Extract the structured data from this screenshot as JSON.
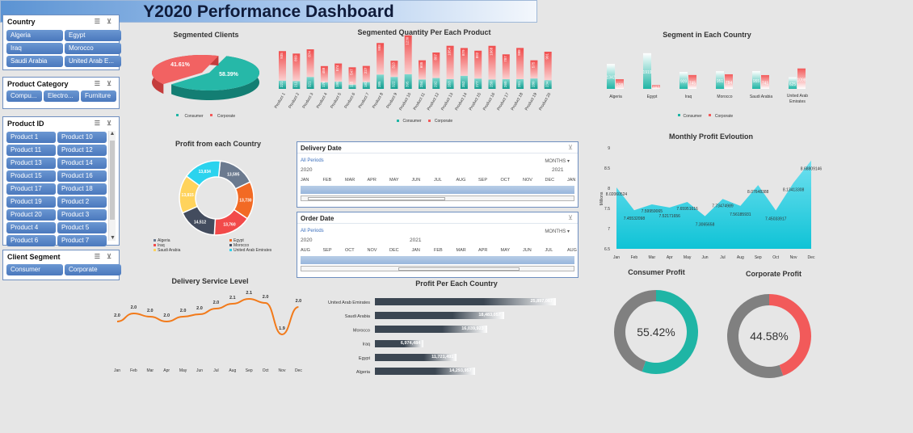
{
  "header": {
    "title": "Y2020 Performance Dashboard"
  },
  "slicers": {
    "country": {
      "title": "Country",
      "items": [
        "Algeria",
        "Egypt",
        "Iraq",
        "Morocco",
        "Saudi Arabia",
        "United Arab E..."
      ]
    },
    "category": {
      "title": "Product Category",
      "items": [
        "Compu...",
        "Electro...",
        "Furniture"
      ]
    },
    "product": {
      "title": "Product ID",
      "items": [
        "Product 1",
        "Product 10",
        "Product 11",
        "Product 12",
        "Product 13",
        "Product 14",
        "Product 15",
        "Product 16",
        "Product 17",
        "Product 18",
        "Product 19",
        "Product 2",
        "Product 20",
        "Product 3",
        "Product 4",
        "Product 5",
        "Product 6",
        "Product 7"
      ]
    },
    "segment": {
      "title": "Client Segment",
      "items": [
        "Consumer",
        "Corporate"
      ]
    }
  },
  "timelines": {
    "delivery": {
      "title": "Delivery Date",
      "all": "All Periods",
      "unit": "MONTHS",
      "years": [
        "2020",
        "2021"
      ],
      "months": [
        "JAN",
        "FEB",
        "MAR",
        "APR",
        "MAY",
        "JUN",
        "JUL",
        "AUG",
        "SEP",
        "OCT",
        "NOV",
        "DEC",
        "JAN"
      ]
    },
    "order": {
      "title": "Order Date",
      "all": "All Periods",
      "unit": "MONTHS",
      "years": [
        "2020",
        "2021"
      ],
      "months": [
        "AUG",
        "SEP",
        "OCT",
        "NOV",
        "DEC",
        "JAN",
        "FEB",
        "MAR",
        "APR",
        "MAY",
        "JUN",
        "JUL",
        "AUG"
      ]
    }
  },
  "colors": {
    "consumer": "#1fb5a5",
    "corporate": "#f25a5a",
    "navy": "#3b4652"
  },
  "chart_data": [
    {
      "id": "segmented_clients",
      "type": "pie",
      "title": "Segmented Clients",
      "labels": [
        "Consumer",
        "Corporate"
      ],
      "values": [
        58.39,
        41.61
      ],
      "value_labels": [
        "58.39%",
        "41.61%"
      ],
      "legend": [
        "Consumer",
        "Corporate"
      ]
    },
    {
      "id": "qty_product",
      "type": "bar",
      "title": "Segmented Quantity Per Each Product",
      "categories": [
        "Product 1",
        "Product 2",
        "Product 3",
        "Product 4",
        "Product 5",
        "Product 6",
        "Product 7",
        "Product 8",
        "Product 9",
        "Product 10",
        "Product 11",
        "Product 12",
        "Product 13",
        "Product 14",
        "Product 15",
        "Product 16",
        "Product 17",
        "Product 18",
        "Product 19",
        "Product 20"
      ],
      "series": [
        {
          "name": "Consumer",
          "values": [
            221,
            211,
            321,
            178,
            195,
            115,
            182,
            385,
            322,
            395,
            254,
            292,
            263,
            352,
            277,
            250,
            260,
            261,
            280,
            234
          ]
        },
        {
          "name": "Corporate",
          "values": [
            935,
            869,
            874,
            458,
            574,
            547,
            227,
            998,
            313,
            1230,
            605,
            807,
            1054,
            879,
            882,
            1068,
            787,
            988,
            575,
            901
          ]
        }
      ],
      "legend": [
        "Consumer",
        "Corporate"
      ]
    },
    {
      "id": "segment_country",
      "type": "bar",
      "title": "Segment in Each Country",
      "categories": [
        "Algeria",
        "Egypt",
        "Iraq",
        "Morocco",
        "Saudi Arabia",
        "United Arab Emirates"
      ],
      "series": [
        {
          "name": "Consumer",
          "values": [
            1342,
            1919,
            909,
            951,
            955,
            625
          ]
        },
        {
          "name": "Corporate",
          "values": [
            518,
            197,
            745,
            784,
            741,
            1098
          ]
        }
      ],
      "legend": [
        "Consumer",
        "Corporate"
      ]
    },
    {
      "id": "profit_country_donut",
      "type": "pie",
      "title": "Profit from each Country",
      "labels": [
        "Algeria",
        "Egypt",
        "Iraq",
        "Morocco",
        "Saudi Arabia",
        "United Arab Emirates"
      ],
      "values": [
        13595,
        13730,
        13760,
        14512,
        13815,
        13834
      ],
      "value_labels": [
        "13,595",
        "13,730",
        "13,760",
        "14,512",
        "13,815",
        "13,834"
      ]
    },
    {
      "id": "monthly_profit",
      "type": "area",
      "title": "Monthly Profit Evloution",
      "ylabel": "Millions",
      "categories": [
        "Jan",
        "Feb",
        "Mar",
        "Apr",
        "May",
        "Jun",
        "Jul",
        "Aug",
        "Sep",
        "Oct",
        "Nov",
        "Dec"
      ],
      "values": [
        8.02060524,
        7.45532098,
        7.59959065,
        7.52171656,
        7.65951616,
        7.3065658,
        7.73474989,
        7.56185931,
        8.07648388,
        7.45033917,
        8.13413308,
        8.68809146
      ],
      "value_labels": [
        "8.02060524",
        "7.45532098",
        "7.59959065",
        "7.52171656",
        "7.65951616",
        "7.3065658",
        "7.73474989",
        "7.56185931",
        "8.07648388",
        "7.45033917",
        "8.13413308",
        "8.68809146"
      ],
      "ylim": [
        6.5,
        9
      ],
      "yticks": [
        "6.5",
        "7",
        "7.5",
        "8",
        "8.5",
        "9"
      ]
    },
    {
      "id": "delivery_service",
      "type": "line",
      "title": "Delivery Service Level",
      "categories": [
        "Jan",
        "Feb",
        "Mar",
        "Apr",
        "May",
        "Jun",
        "Jul",
        "Aug",
        "Sep",
        "Oct",
        "Nov",
        "Dec"
      ],
      "values": [
        2.0,
        2.0,
        2.0,
        2.0,
        2.0,
        2.0,
        2.0,
        2.1,
        2.1,
        2.0,
        1.9,
        2.0
      ],
      "value_labels": [
        "2.0",
        "2.0",
        "2.0",
        "2.0",
        "2.0",
        "2.0",
        "2.0",
        "2.1",
        "2.1",
        "2.0",
        "1.9",
        "2.0"
      ]
    },
    {
      "id": "profit_country_bar",
      "type": "bar",
      "title": "Profit Per Each Country",
      "categories": [
        "United Arab Emirates",
        "Saudi Arabia",
        "Morocco",
        "Iraq",
        "Egypt",
        "Algeria"
      ],
      "values": [
        25897087,
        18483057,
        16039923,
        6974484,
        11721491,
        14293957
      ],
      "value_labels": [
        "25,897,087",
        "18,483,057",
        "16,039,923",
        "6,974,484",
        "11,721,491",
        "14,293,957"
      ]
    },
    {
      "id": "consumer_profit",
      "type": "pie",
      "title": "Consumer Profit",
      "values": [
        55.42,
        44.58
      ],
      "value_label": "55.42%"
    },
    {
      "id": "corporate_profit",
      "type": "pie",
      "title": "Corporate Profit",
      "values": [
        44.58,
        55.42
      ],
      "value_label": "44.58%"
    }
  ]
}
